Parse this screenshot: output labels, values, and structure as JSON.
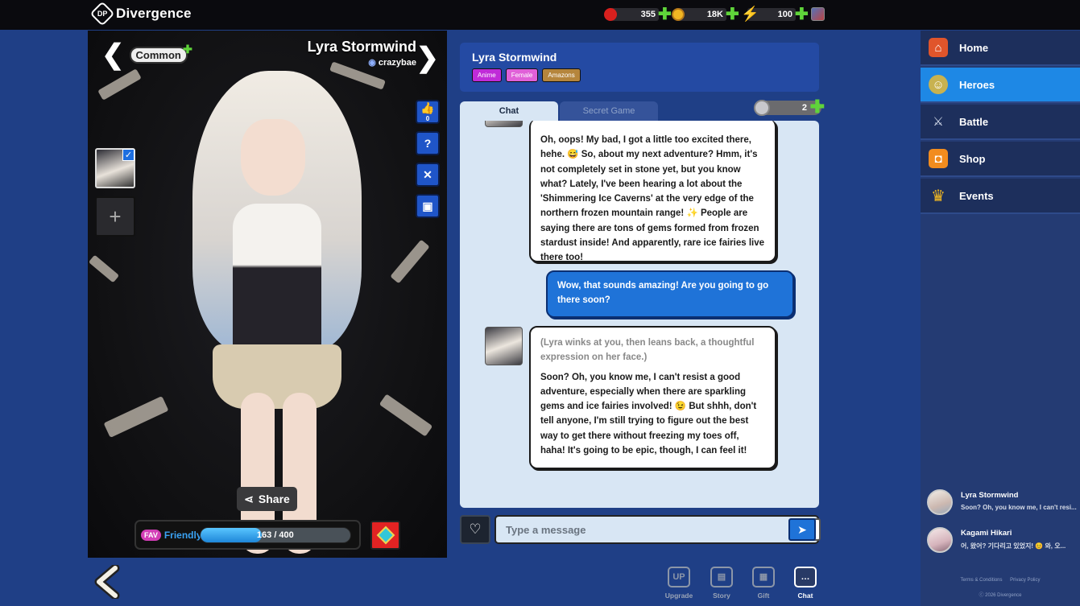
{
  "app": {
    "brand": "Divergence"
  },
  "resources": {
    "rubies": "355",
    "coins": "18K",
    "energy": "100"
  },
  "hero": {
    "name": "Lyra Stormwind",
    "creator": "crazybae",
    "rarity": "Common",
    "likes": "0",
    "bond_label": "Friendly",
    "fav_label": "FAV",
    "bond_progress": "163 / 400",
    "bond_fraction": 0.4075,
    "share_label": "Share"
  },
  "chat": {
    "header_name": "Lyra Stormwind",
    "tags": [
      {
        "label": "Anime",
        "bg": "#c02bd8",
        "fg": "#fff"
      },
      {
        "label": "Female",
        "bg": "#e060d8",
        "fg": "#fff"
      },
      {
        "label": "Amazons",
        "bg": "#b5853c",
        "fg": "#fff"
      }
    ],
    "tab_chat": "Chat",
    "tab_secret": "Secret Game",
    "tokens": "2",
    "messages": {
      "m1": "Oh, oops! My bad, I got a little too excited there, hehe. 😅 So, about my next adventure? Hmm, it's not completely set in stone yet, but you know what? Lately, I've been hearing a lot about the 'Shimmering Ice Caverns' at the very edge of the northern frozen mountain range! ✨ People are saying there are tons of gems formed from frozen stardust inside! And apparently, rare ice fairies live there too!",
      "m2": "Wow, that sounds amazing! Are you going to go there soon?",
      "m3_narr": "(Lyra winks at you, then leans back, a thoughtful expression on her face.)",
      "m3": "Soon? Oh, you know me, I can't resist a good adventure, especially when there are sparkling gems and ice fairies involved! 😉 But shhh, don't tell anyone, I'm still trying to figure out the best way to get there without freezing my toes off, haha! It's going to be epic, though, I can feel it!"
    },
    "input_placeholder": "Type a message"
  },
  "bottom_nav": {
    "upgrade": "Upgrade",
    "story": "Story",
    "gift": "Gift",
    "chat": "Chat"
  },
  "sidebar": {
    "items": [
      {
        "label": "Home"
      },
      {
        "label": "Heroes"
      },
      {
        "label": "Battle"
      },
      {
        "label": "Shop"
      },
      {
        "label": "Events"
      }
    ],
    "recent": [
      {
        "name": "Lyra Stormwind",
        "preview": "Soon? Oh, you know me, I can't resi..."
      },
      {
        "name": "Kagami Hikari",
        "preview": "어, 왔어? 기다리고 있었지! 😊 와, 오..."
      }
    ],
    "terms": "Terms & Conditions",
    "privacy": "Privacy Policy",
    "copyright": "ⓒ 2026 Divergence"
  },
  "colors": {
    "background": "#1f3f86",
    "accent_blue": "#1e88e5",
    "plus_green": "#5fd43a",
    "gem_red": "#e22323"
  }
}
